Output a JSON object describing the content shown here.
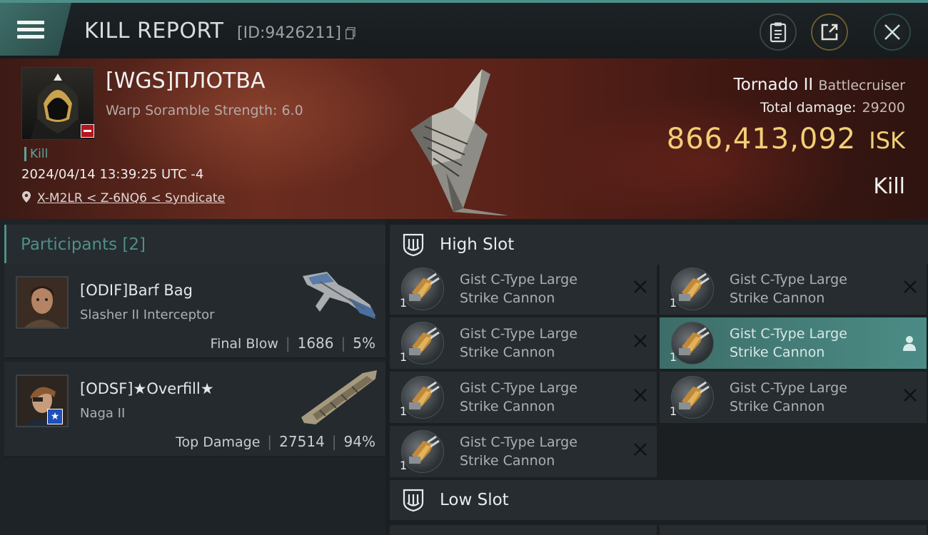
{
  "header": {
    "title": "KILL REPORT",
    "report_id": "[ID:9426211]"
  },
  "victim": {
    "name": "[WGS]ПЛОТВА",
    "scramble": "Warp Soramble Strength: 6.0",
    "tag": "Kill",
    "datetime": "2024/04/14 13:39:25 UTC -4",
    "location": "X-M2LR < Z-6NQ6 < Syndicate",
    "ship_name": "Tornado II",
    "ship_class": "Battlecruiser",
    "total_damage_label": "Total damage:",
    "total_damage": "29200",
    "isk_value": "866,413,092",
    "isk_unit": "ISK",
    "result": "Kill"
  },
  "participants": {
    "label": "Participants",
    "count": "[2]",
    "items": [
      {
        "name": "[ODIF]Barf Bag",
        "ship": "Slasher II Interceptor",
        "role": "Final Blow",
        "damage": "1686",
        "percent": "5%"
      },
      {
        "name": "[ODSF]★Overfill★",
        "ship": "Naga II",
        "role": "Top Damage",
        "damage": "27514",
        "percent": "94%"
      }
    ]
  },
  "slots": {
    "high_label": "High Slot",
    "low_label": "Low Slot",
    "high_items": [
      {
        "line1": "Gist C-Type Large",
        "line2": "Strike Cannon",
        "qty": "1"
      },
      {
        "line1": "Gist C-Type Large",
        "line2": "Strike Cannon",
        "qty": "1"
      },
      {
        "line1": "Gist C-Type Large",
        "line2": "Strike Cannon",
        "qty": "1"
      },
      {
        "line1": "Gist C-Type Large",
        "line2": "Strike Cannon",
        "qty": "1"
      },
      {
        "line1": "Gist C-Type Large",
        "line2": "Strike Cannon",
        "qty": "1"
      },
      {
        "line1": "Gist C-Type Large",
        "line2": "Strike Cannon",
        "qty": "1"
      },
      {
        "line1": "Gist C-Type Large",
        "line2": "Strike Cannon",
        "qty": "1"
      }
    ]
  },
  "colors": {
    "accent": "#4f8f88",
    "isk": "#f2cf76",
    "banner": "#6b2c1f"
  }
}
